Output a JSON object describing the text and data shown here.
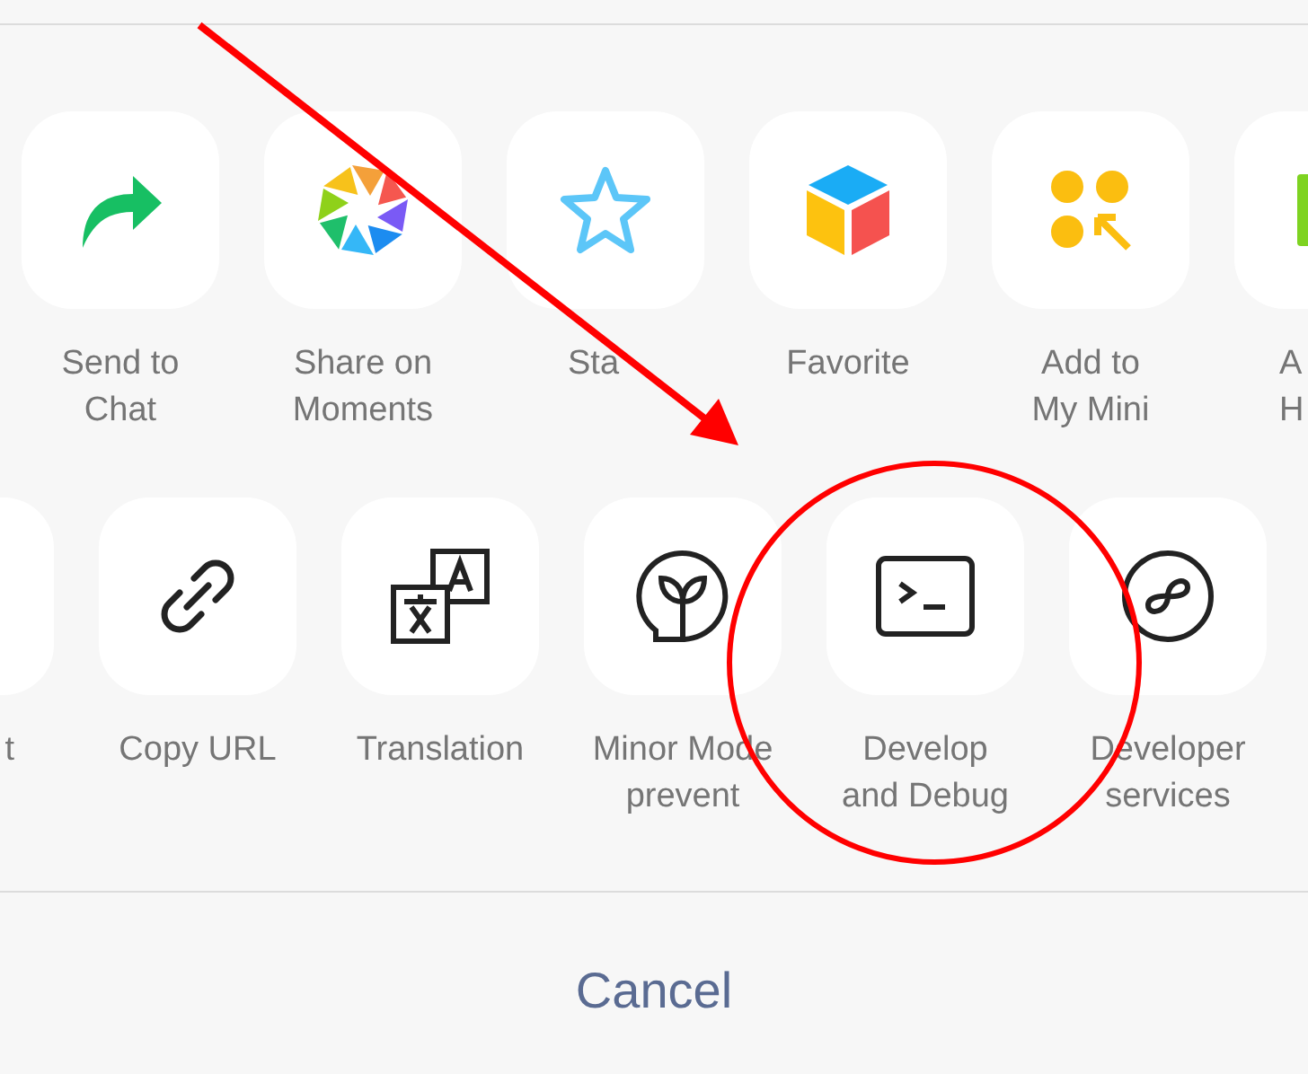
{
  "rows": [
    {
      "items": [
        {
          "kind": "full",
          "lines": [
            "Send to",
            "Chat"
          ]
        },
        {
          "kind": "full",
          "lines": [
            "Share on",
            "Moments"
          ]
        },
        {
          "kind": "covered",
          "lines": [
            "Sta"
          ]
        },
        {
          "kind": "full",
          "lines": [
            "Favorite"
          ]
        },
        {
          "kind": "full",
          "lines": [
            "Add to",
            "My Mini"
          ]
        },
        {
          "kind": "cut_right",
          "lines": [
            "A",
            "H"
          ]
        }
      ]
    },
    {
      "items": [
        {
          "kind": "cut_left",
          "lines": [
            "t"
          ]
        },
        {
          "kind": "full",
          "lines": [
            "Copy URL"
          ]
        },
        {
          "kind": "full",
          "lines": [
            "Translation"
          ]
        },
        {
          "kind": "full",
          "lines": [
            "Minor Mode",
            "prevent"
          ]
        },
        {
          "kind": "full",
          "lines": [
            "Develop",
            "and Debug"
          ]
        },
        {
          "kind": "full",
          "lines": [
            "Developer",
            "services"
          ]
        }
      ]
    }
  ],
  "cancel": "Cancel"
}
